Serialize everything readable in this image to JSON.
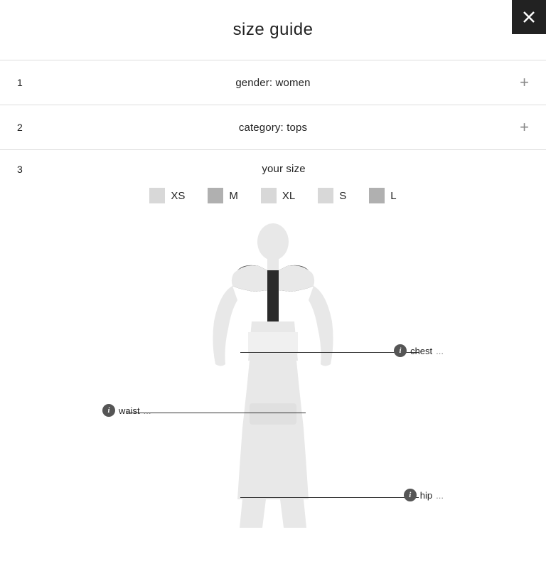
{
  "page": {
    "title": "size guide"
  },
  "close_button": {
    "label": "×"
  },
  "steps": [
    {
      "number": "1",
      "label": "gender: women",
      "expandable": true
    },
    {
      "number": "2",
      "label": "category: tops",
      "expandable": true
    },
    {
      "number": "3",
      "label": "your size",
      "expandable": false
    }
  ],
  "sizes": [
    {
      "id": "xs",
      "label": "XS",
      "selected": false
    },
    {
      "id": "m",
      "label": "M",
      "selected": true
    },
    {
      "id": "xl",
      "label": "XL",
      "selected": false
    },
    {
      "id": "s",
      "label": "S",
      "selected": false
    },
    {
      "id": "l",
      "label": "L",
      "selected": true
    }
  ],
  "measurements": {
    "chest": {
      "label": "chest",
      "dots": "..."
    },
    "waist": {
      "label": "waist",
      "dots": "..."
    },
    "hip": {
      "label": "hip",
      "dots": "..."
    }
  }
}
